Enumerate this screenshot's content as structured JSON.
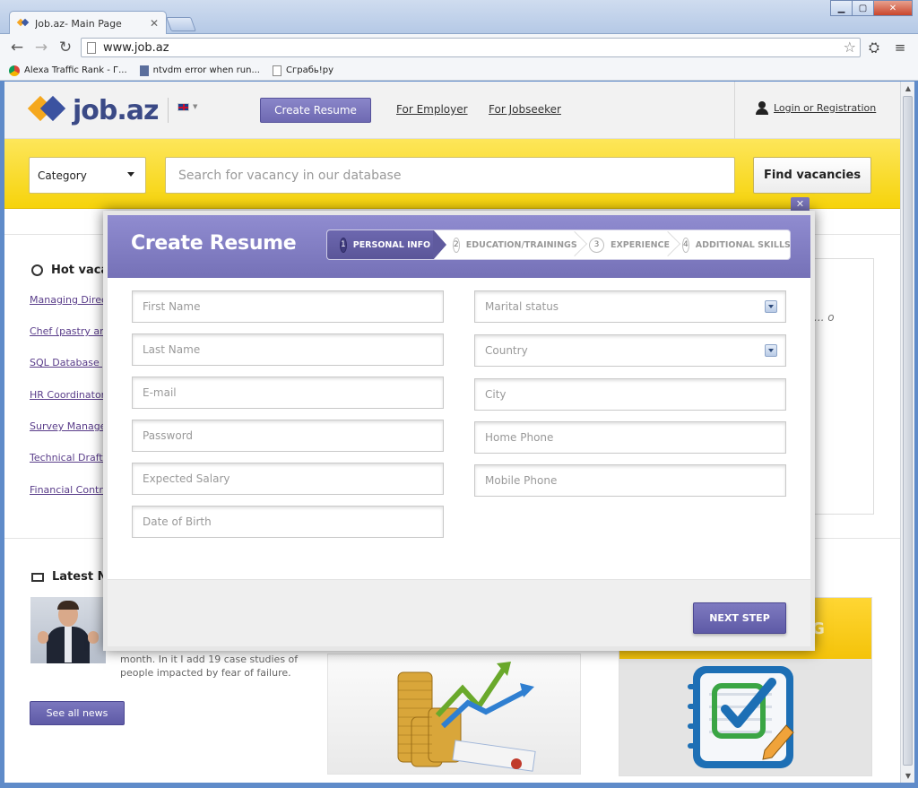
{
  "browser": {
    "tab_title": "Job.az- Main Page",
    "tab_close": "✕",
    "address": "www.job.az",
    "bookmarks": [
      {
        "label": "Alexa Traffic Rank - Г...",
        "icon": "chrome-icon"
      },
      {
        "label": "ntvdm error when run...",
        "icon": "document-icon"
      },
      {
        "label": "Сграбь!ру",
        "icon": "page-icon"
      }
    ],
    "window_buttons": {
      "minimize": "▁",
      "maximize": "▢",
      "close": "✕"
    }
  },
  "site": {
    "logo_text": "job.az",
    "create_resume": "Create Resume",
    "for_employer": "For Employer",
    "for_jobseeker": "For Jobseeker",
    "login": "Login or Registration"
  },
  "search": {
    "category": "Category",
    "placeholder": "Search for vacancy in our database",
    "find_button": "Find vacancies"
  },
  "hot_vacancies": {
    "title": "Hot vaca",
    "items": [
      "Managing Direc",
      "Chef (pastry and",
      "SQL Database p",
      "HR Coordinator",
      "Survey Manager",
      "Technical Drafts",
      "Financial Contro"
    ]
  },
  "right_card_dots": "... o",
  "news": {
    "title": "Latest Ne",
    "excerpt": "month. In it I add 19 case studies of people impacted by fear of failure.",
    "see_all": "See all news"
  },
  "promo2_banner": "NG",
  "modal": {
    "close": "✕",
    "title": "Create Resume",
    "steps": [
      {
        "num": "1",
        "label": "PERSONAL INFO",
        "active": true
      },
      {
        "num": "2",
        "label": "EDUCATION/TRAININGS",
        "active": false
      },
      {
        "num": "3",
        "label": "EXPERIENCE",
        "active": false
      },
      {
        "num": "4",
        "label": "ADDITIONAL SKILLS",
        "active": false
      }
    ],
    "left_fields": [
      "First Name",
      "Last Name",
      "E-mail",
      "Password",
      "Expected Salary",
      "Date of Birth"
    ],
    "right_fields": [
      "Marital status",
      "Country",
      "City",
      "Home Phone",
      "Mobile Phone"
    ],
    "next_step": "NEXT STEP"
  },
  "colors": {
    "brand_purple": "#7571b7",
    "search_yellow": "#f6d30b",
    "link_purple": "#5a3d8a"
  }
}
